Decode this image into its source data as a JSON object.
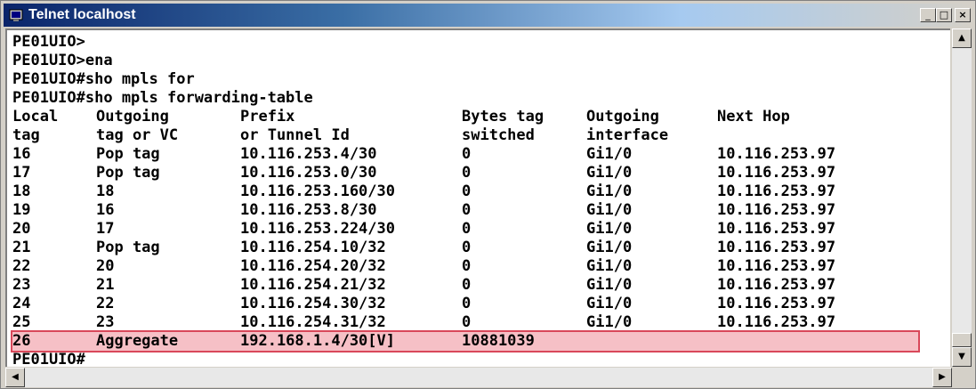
{
  "window": {
    "title": "Telnet localhost",
    "controls": {
      "minimize": "_",
      "maximize": "□",
      "close": "×"
    }
  },
  "icons": {
    "app": "telnet-app-icon",
    "scroll_up": "arrow-up-icon",
    "scroll_down": "arrow-down-icon",
    "scroll_left": "arrow-left-icon",
    "scroll_right": "arrow-right-icon"
  },
  "colors": {
    "title_gradient_start": "#0a246a",
    "highlight_fill": "#f6c0c6",
    "highlight_border": "#d9485a"
  },
  "terminal": {
    "pre_lines": [
      "PE01UIO>",
      "PE01UIO>ena",
      "PE01UIO#sho mpls for",
      "PE01UIO#sho mpls forwarding-table"
    ],
    "header": [
      [
        "Local",
        "Outgoing",
        "Prefix",
        "Bytes tag",
        "Outgoing",
        "Next Hop"
      ],
      [
        "tag",
        "tag or VC",
        "or Tunnel Id",
        "switched",
        "interface",
        ""
      ]
    ],
    "rows": [
      [
        "16",
        "Pop tag",
        "10.116.253.4/30",
        "0",
        "Gi1/0",
        "10.116.253.97"
      ],
      [
        "17",
        "Pop tag",
        "10.116.253.0/30",
        "0",
        "Gi1/0",
        "10.116.253.97"
      ],
      [
        "18",
        "18",
        "10.116.253.160/30",
        "0",
        "Gi1/0",
        "10.116.253.97"
      ],
      [
        "19",
        "16",
        "10.116.253.8/30",
        "0",
        "Gi1/0",
        "10.116.253.97"
      ],
      [
        "20",
        "17",
        "10.116.253.224/30",
        "0",
        "Gi1/0",
        "10.116.253.97"
      ],
      [
        "21",
        "Pop tag",
        "10.116.254.10/32",
        "0",
        "Gi1/0",
        "10.116.253.97"
      ],
      [
        "22",
        "20",
        "10.116.254.20/32",
        "0",
        "Gi1/0",
        "10.116.253.97"
      ],
      [
        "23",
        "21",
        "10.116.254.21/32",
        "0",
        "Gi1/0",
        "10.116.253.97"
      ],
      [
        "24",
        "22",
        "10.116.254.30/32",
        "0",
        "Gi1/0",
        "10.116.253.97"
      ],
      [
        "25",
        "23",
        "10.116.254.31/32",
        "0",
        "Gi1/0",
        "10.116.253.97"
      ]
    ],
    "highlighted_row": [
      "26",
      "Aggregate",
      "192.168.1.4/30[V]",
      "10881039",
      "",
      ""
    ],
    "prompt": "PE01UIO#"
  }
}
